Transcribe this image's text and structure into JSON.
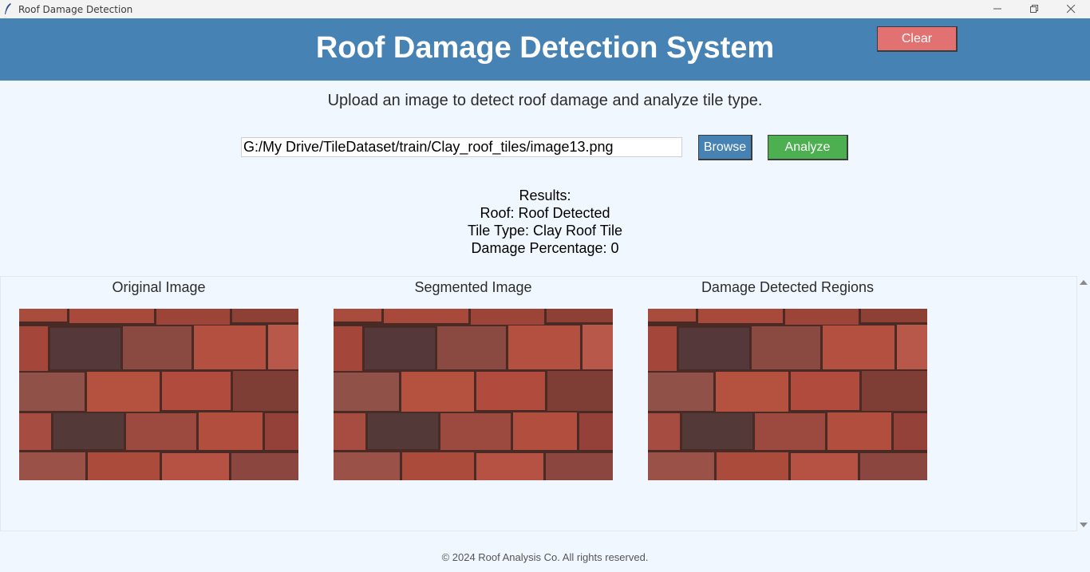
{
  "window": {
    "title": "Roof Damage Detection"
  },
  "header": {
    "title": "Roof Damage Detection System",
    "clear_label": "Clear"
  },
  "subtitle": "Upload an image to detect roof damage and analyze tile type.",
  "file": {
    "path": "G:/My Drive/TileDataset/train/Clay_roof_tiles/image13.png",
    "browse_label": "Browse",
    "analyze_label": "Analyze"
  },
  "results": {
    "heading": "Results:",
    "roof": "Roof: Roof Detected",
    "tile_type": "Tile Type: Clay Roof Tile",
    "damage": "Damage Percentage: 0"
  },
  "images": {
    "original_label": "Original Image",
    "segmented_label": "Segmented Image",
    "damage_label": "Damage Detected Regions"
  },
  "footer": "© 2024 Roof Analysis Co. All rights reserved.",
  "colors": {
    "header": "#4682b4",
    "clear_button": "#e27171",
    "browse_button": "#4682b4",
    "analyze_button": "#4caf50",
    "background": "#f0f7fe"
  },
  "icons": [
    "feather-icon",
    "minimize-icon",
    "restore-icon",
    "close-icon",
    "scroll-up-icon",
    "scroll-down-icon"
  ]
}
